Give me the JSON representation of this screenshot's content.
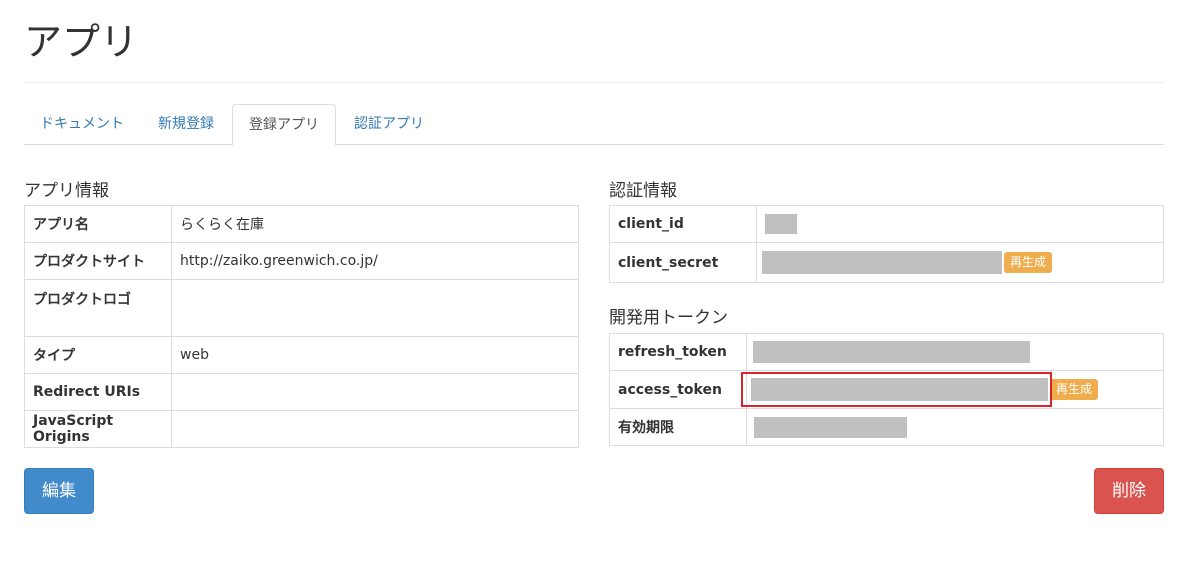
{
  "page": {
    "title": "アプリ"
  },
  "tabs": [
    {
      "label": "ドキュメント",
      "active": false
    },
    {
      "label": "新規登録",
      "active": false
    },
    {
      "label": "登録アプリ",
      "active": true
    },
    {
      "label": "認証アプリ",
      "active": false
    }
  ],
  "app_info": {
    "title": "アプリ情報",
    "rows": [
      {
        "key": "アプリ名",
        "value": "らくらく在庫"
      },
      {
        "key": "プロダクトサイト",
        "value": "http://zaiko.greenwich.co.jp/"
      },
      {
        "key": "プロダクトロゴ",
        "value": ""
      },
      {
        "key": "タイプ",
        "value": "web"
      },
      {
        "key": "Redirect URIs",
        "value": ""
      },
      {
        "key": "JavaScript Origins",
        "value": ""
      }
    ]
  },
  "auth_info": {
    "title": "認証情報",
    "client_id_key": "client_id",
    "client_secret_key": "client_secret",
    "regenerate_label": "再生成"
  },
  "dev_tokens": {
    "title": "開発用トークン",
    "refresh_token_key": "refresh_token",
    "access_token_key": "access_token",
    "expiry_key": "有効期限",
    "regenerate_label": "再生成"
  },
  "actions": {
    "edit_label": "編集",
    "delete_label": "削除"
  },
  "colors": {
    "link": "#337ab7",
    "primary": "#428bca",
    "danger": "#d9534f",
    "warning": "#f0ad4e",
    "highlight": "#d9232d"
  }
}
